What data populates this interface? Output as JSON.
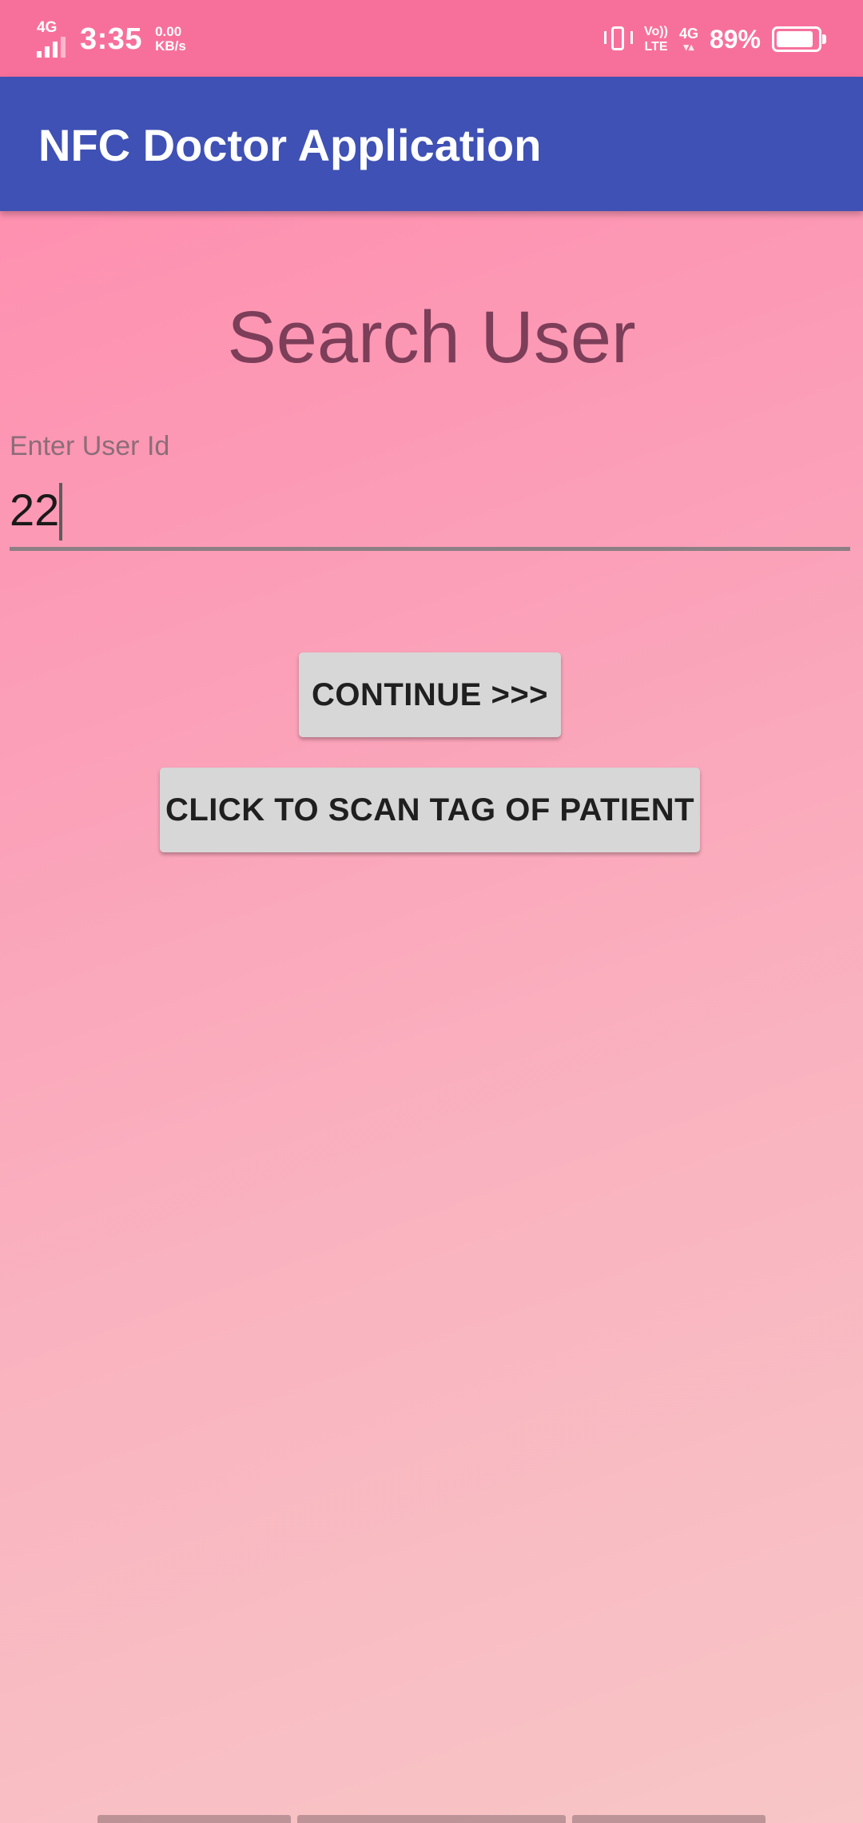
{
  "status_bar": {
    "network_left": "4G",
    "time": "3:35",
    "speed_value": "0.00",
    "speed_unit": "KB/s",
    "volte_top": "Vo))",
    "volte_bottom": "LTE",
    "network_right": "4G",
    "battery_percent": "89%",
    "battery_level": 0.89,
    "icons": [
      "signal-icon",
      "vibrate-icon",
      "battery-icon"
    ]
  },
  "app_bar": {
    "title": "NFC Doctor Application",
    "color": "#3f51b5"
  },
  "main": {
    "heading": "Search User",
    "user_id_field": {
      "label": "Enter User Id",
      "value": "22"
    },
    "continue_button": "CONTINUE >>>",
    "scan_button": "CLICK TO SCAN TAG OF PATIENT"
  },
  "colors": {
    "status_bar": "#f7709b",
    "background_top": "#ff8aad",
    "background_bottom": "#f8c6c6",
    "heading": "#7c3e58",
    "button": "#d7d7d7"
  }
}
